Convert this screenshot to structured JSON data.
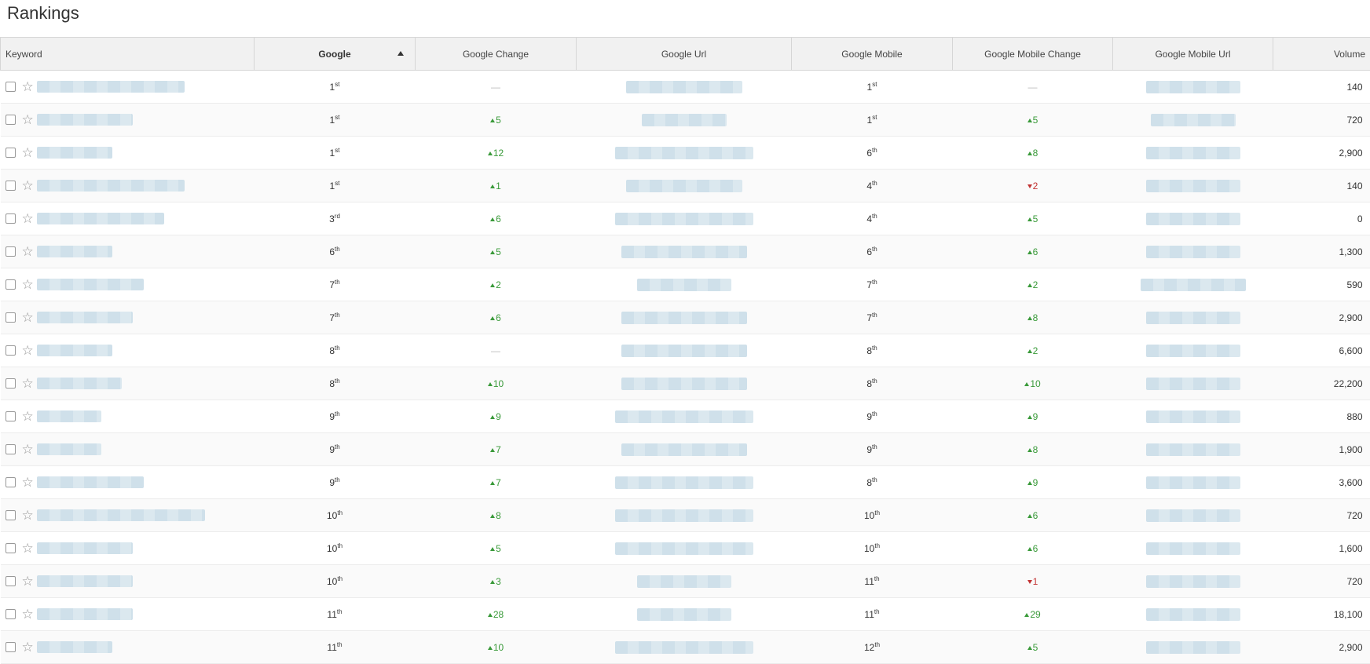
{
  "page": {
    "title": "Rankings"
  },
  "columns": {
    "keyword": "Keyword",
    "google": "Google",
    "google_change": "Google Change",
    "google_url": "Google Url",
    "google_mobile": "Google Mobile",
    "google_mobile_change": "Google Mobile Change",
    "google_mobile_url": "Google Mobile Url",
    "volume": "Volume"
  },
  "sort": {
    "column": "google",
    "direction": "ascending"
  },
  "colors": {
    "up": "#3a9a3a",
    "down": "#c23333",
    "same": "#b9b9b9"
  },
  "rows": [
    {
      "google_num": "1",
      "google_suffix": "st",
      "google_change": {
        "dir": "same",
        "text": "—"
      },
      "mobile_num": "1",
      "mobile_suffix": "st",
      "mobile_change": {
        "dir": "same",
        "text": "—"
      },
      "volume": "140"
    },
    {
      "google_num": "1",
      "google_suffix": "st",
      "google_change": {
        "dir": "up",
        "text": "5"
      },
      "mobile_num": "1",
      "mobile_suffix": "st",
      "mobile_change": {
        "dir": "up",
        "text": "5"
      },
      "volume": "720"
    },
    {
      "google_num": "1",
      "google_suffix": "st",
      "google_change": {
        "dir": "up",
        "text": "12"
      },
      "mobile_num": "6",
      "mobile_suffix": "th",
      "mobile_change": {
        "dir": "up",
        "text": "8"
      },
      "volume": "2,900"
    },
    {
      "google_num": "1",
      "google_suffix": "st",
      "google_change": {
        "dir": "up",
        "text": "1"
      },
      "mobile_num": "4",
      "mobile_suffix": "th",
      "mobile_change": {
        "dir": "down",
        "text": "2"
      },
      "volume": "140"
    },
    {
      "google_num": "3",
      "google_suffix": "rd",
      "google_change": {
        "dir": "up",
        "text": "6"
      },
      "mobile_num": "4",
      "mobile_suffix": "th",
      "mobile_change": {
        "dir": "up",
        "text": "5"
      },
      "volume": "0"
    },
    {
      "google_num": "6",
      "google_suffix": "th",
      "google_change": {
        "dir": "up",
        "text": "5"
      },
      "mobile_num": "6",
      "mobile_suffix": "th",
      "mobile_change": {
        "dir": "up",
        "text": "6"
      },
      "volume": "1,300"
    },
    {
      "google_num": "7",
      "google_suffix": "th",
      "google_change": {
        "dir": "up",
        "text": "2"
      },
      "mobile_num": "7",
      "mobile_suffix": "th",
      "mobile_change": {
        "dir": "up",
        "text": "2"
      },
      "volume": "590"
    },
    {
      "google_num": "7",
      "google_suffix": "th",
      "google_change": {
        "dir": "up",
        "text": "6"
      },
      "mobile_num": "7",
      "mobile_suffix": "th",
      "mobile_change": {
        "dir": "up",
        "text": "8"
      },
      "volume": "2,900"
    },
    {
      "google_num": "8",
      "google_suffix": "th",
      "google_change": {
        "dir": "same",
        "text": "—"
      },
      "mobile_num": "8",
      "mobile_suffix": "th",
      "mobile_change": {
        "dir": "up",
        "text": "2"
      },
      "volume": "6,600"
    },
    {
      "google_num": "8",
      "google_suffix": "th",
      "google_change": {
        "dir": "up",
        "text": "10"
      },
      "mobile_num": "8",
      "mobile_suffix": "th",
      "mobile_change": {
        "dir": "up",
        "text": "10"
      },
      "volume": "22,200"
    },
    {
      "google_num": "9",
      "google_suffix": "th",
      "google_change": {
        "dir": "up",
        "text": "9"
      },
      "mobile_num": "9",
      "mobile_suffix": "th",
      "mobile_change": {
        "dir": "up",
        "text": "9"
      },
      "volume": "880"
    },
    {
      "google_num": "9",
      "google_suffix": "th",
      "google_change": {
        "dir": "up",
        "text": "7"
      },
      "mobile_num": "9",
      "mobile_suffix": "th",
      "mobile_change": {
        "dir": "up",
        "text": "8"
      },
      "volume": "1,900"
    },
    {
      "google_num": "9",
      "google_suffix": "th",
      "google_change": {
        "dir": "up",
        "text": "7"
      },
      "mobile_num": "8",
      "mobile_suffix": "th",
      "mobile_change": {
        "dir": "up",
        "text": "9"
      },
      "volume": "3,600"
    },
    {
      "google_num": "10",
      "google_suffix": "th",
      "google_change": {
        "dir": "up",
        "text": "8"
      },
      "mobile_num": "10",
      "mobile_suffix": "th",
      "mobile_change": {
        "dir": "up",
        "text": "6"
      },
      "volume": "720"
    },
    {
      "google_num": "10",
      "google_suffix": "th",
      "google_change": {
        "dir": "up",
        "text": "5"
      },
      "mobile_num": "10",
      "mobile_suffix": "th",
      "mobile_change": {
        "dir": "up",
        "text": "6"
      },
      "volume": "1,600"
    },
    {
      "google_num": "10",
      "google_suffix": "th",
      "google_change": {
        "dir": "up",
        "text": "3"
      },
      "mobile_num": "11",
      "mobile_suffix": "th",
      "mobile_change": {
        "dir": "down",
        "text": "1"
      },
      "volume": "720"
    },
    {
      "google_num": "11",
      "google_suffix": "th",
      "google_change": {
        "dir": "up",
        "text": "28"
      },
      "mobile_num": "11",
      "mobile_suffix": "th",
      "mobile_change": {
        "dir": "up",
        "text": "29"
      },
      "volume": "18,100"
    },
    {
      "google_num": "11",
      "google_suffix": "th",
      "google_change": {
        "dir": "up",
        "text": "10"
      },
      "mobile_num": "12",
      "mobile_suffix": "th",
      "mobile_change": {
        "dir": "up",
        "text": "5"
      },
      "volume": "2,900"
    }
  ]
}
